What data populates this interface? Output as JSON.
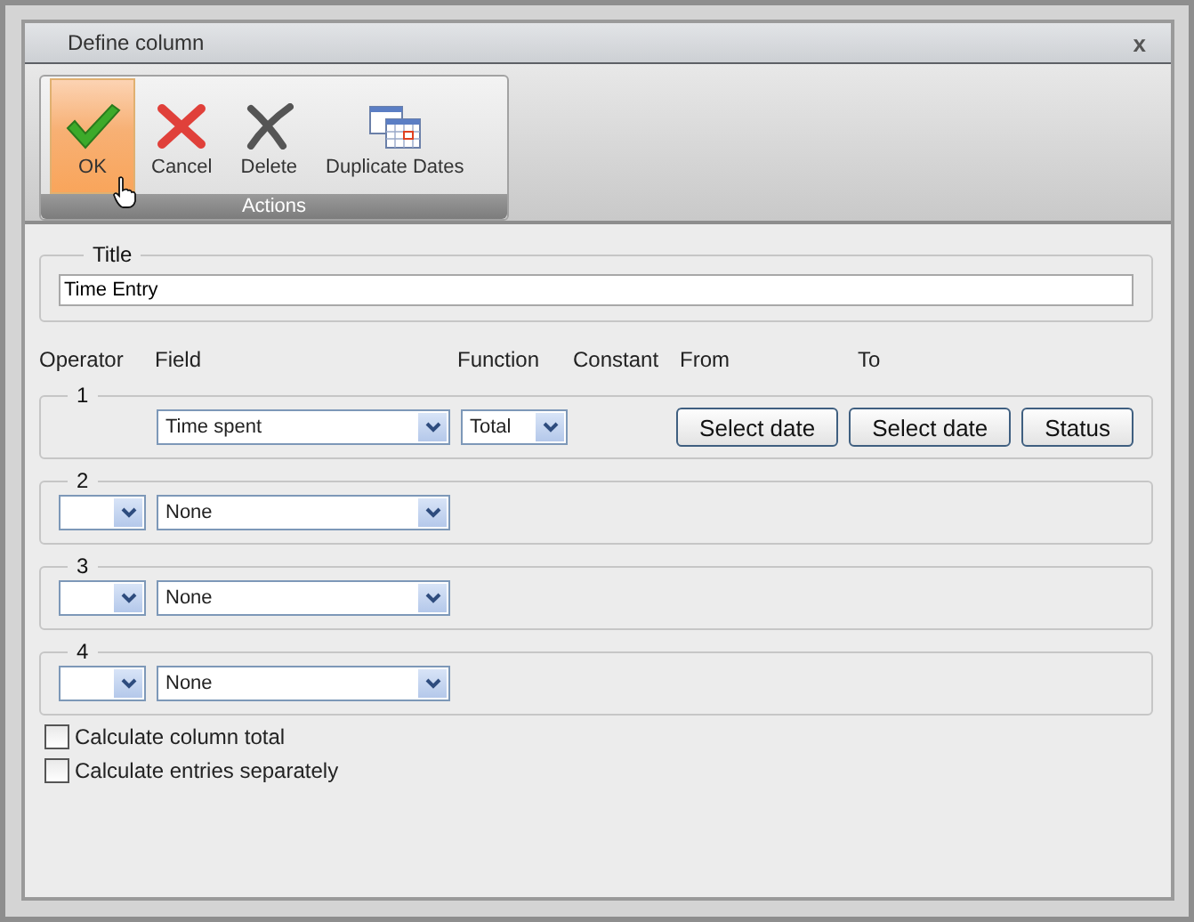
{
  "window": {
    "title": "Define column",
    "close": "x"
  },
  "toolbar": {
    "group_label": "Actions",
    "actions": [
      {
        "kind": "ok",
        "label": "OK",
        "selected": true
      },
      {
        "kind": "cancel",
        "label": "Cancel",
        "selected": false
      },
      {
        "kind": "delete",
        "label": "Delete",
        "selected": false
      },
      {
        "kind": "calendar",
        "label": "Duplicate Dates",
        "selected": false
      }
    ]
  },
  "title_group": {
    "legend": "Title",
    "value": "Time Entry"
  },
  "headers": [
    "Operator",
    "Field",
    "Function",
    "Constant",
    "From",
    "To"
  ],
  "rows": [
    {
      "legend": "1",
      "kind": "first",
      "field": "Time spent",
      "function": "Total",
      "buttons": [
        "Select date",
        "Select date",
        "Status"
      ]
    },
    {
      "legend": "2",
      "kind": "operator",
      "operator": "",
      "field": "None"
    },
    {
      "legend": "3",
      "kind": "operator",
      "operator": "",
      "field": "None"
    },
    {
      "legend": "4",
      "kind": "operator",
      "operator": "",
      "field": "None"
    }
  ],
  "checkboxes": [
    {
      "label": "Calculate column total",
      "checked": false
    },
    {
      "label": "Calculate entries separately",
      "checked": false
    }
  ]
}
